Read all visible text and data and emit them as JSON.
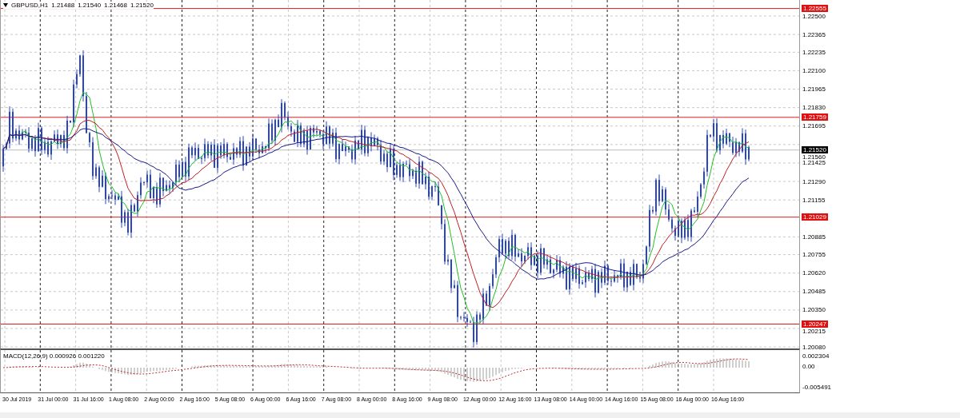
{
  "chart": {
    "symbol": "GBPUSD,H1",
    "ohlc": [
      "1.21488",
      "1.21540",
      "1.21468",
      "1.21520"
    ],
    "price_ticks": [
      "1.22500",
      "1.22365",
      "1.22235",
      "1.22100",
      "1.21965",
      "1.21830",
      "1.21695",
      "1.21560",
      "1.21425",
      "1.21290",
      "1.21155",
      "1.20885",
      "1.20755",
      "1.20620",
      "1.20485",
      "1.20350",
      "1.20215",
      "1.20080"
    ],
    "price_lines": [
      {
        "label": "1.22555",
        "kind": "level"
      },
      {
        "label": "1.21759",
        "kind": "level"
      },
      {
        "label": "1.21520",
        "kind": "bid"
      },
      {
        "label": "1.21029",
        "kind": "level"
      },
      {
        "label": "1.20247",
        "kind": "level"
      }
    ]
  },
  "macd": {
    "title": "MACD(12,26,9) 0.000926 0.001220",
    "ticks": [
      "0.002304",
      "0.00",
      "-0.005491"
    ]
  },
  "time_labels": [
    "30 Jul 2019",
    "31 Jul 00:00",
    "31 Jul 16:00",
    "1 Aug 08:00",
    "2 Aug 00:00",
    "2 Aug 16:00",
    "5 Aug 08:00",
    "6 Aug 00:00",
    "6 Aug 16:00",
    "7 Aug 08:00",
    "8 Aug 00:00",
    "8 Aug 16:00",
    "9 Aug 08:00",
    "12 Aug 00:00",
    "12 Aug 16:00",
    "13 Aug 08:00",
    "14 Aug 00:00",
    "14 Aug 16:00",
    "15 Aug 08:00",
    "16 Aug 00:00",
    "16 Aug 16:00"
  ]
}
